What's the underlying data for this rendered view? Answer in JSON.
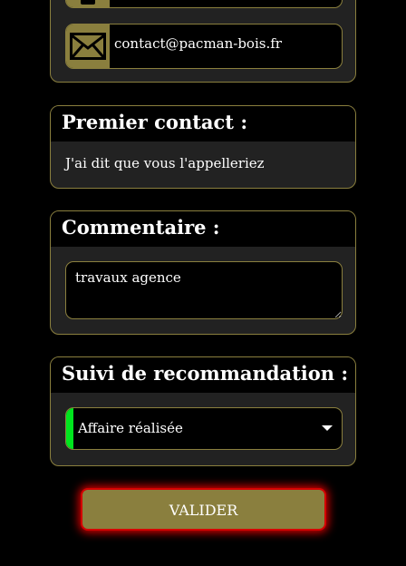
{
  "contact_card": {
    "email": "contact@pacman-bois.fr"
  },
  "premier_contact": {
    "title": "Premier contact :",
    "value": "J'ai dit que vous l'appelleriez"
  },
  "commentaire": {
    "title": "Commentaire :",
    "value": "travaux agence"
  },
  "suivi": {
    "title": "Suivi de recommandation :",
    "selected": "Affaire réalisée",
    "status_color": "#00e51e"
  },
  "submit": {
    "label": "VALIDER"
  },
  "colors": {
    "accent": "#8a7f3e",
    "background": "#000000",
    "card": "#222222",
    "glow": "#e00000"
  },
  "icons": [
    "phone-icon",
    "mail-icon",
    "dropdown-caret-icon"
  ]
}
